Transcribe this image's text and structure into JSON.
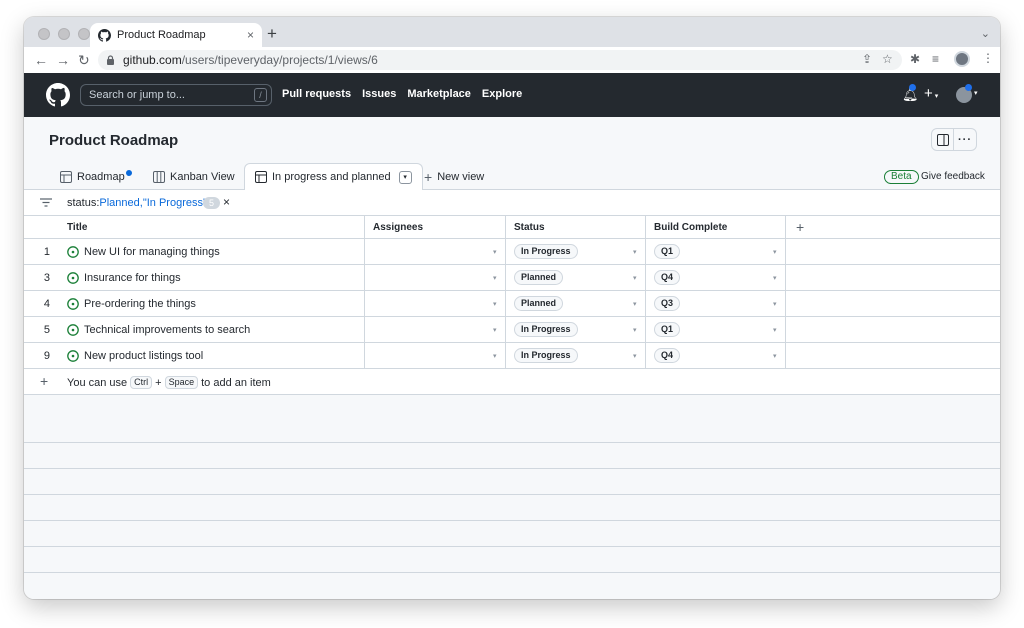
{
  "browser": {
    "tab_title": "Product Roadmap",
    "tab_close": "×",
    "new_tab": "+",
    "url_host": "github.com",
    "url_path": "/users/tipeveryday/projects/1/views/6"
  },
  "github_header": {
    "search_placeholder": "Search or jump to...",
    "search_shortcut": "/",
    "nav": [
      "Pull requests",
      "Issues",
      "Marketplace",
      "Explore"
    ],
    "plus_label": "+"
  },
  "project": {
    "title": "Product Roadmap",
    "more_label": "···",
    "views": [
      {
        "label": "Roadmap",
        "icon": "table-icon",
        "unsaved_dot": true
      },
      {
        "label": "Kanban View",
        "icon": "board-icon"
      },
      {
        "label": "In progress and planned",
        "icon": "table-icon",
        "active": true
      },
      {
        "label": "New view",
        "icon": "plus-icon"
      }
    ],
    "beta_label": "Beta",
    "feedback_label": "Give feedback"
  },
  "filter": {
    "key": "status:",
    "value": "Planned,\"In Progress\"",
    "count": "5",
    "clear": "×"
  },
  "table": {
    "columns": [
      "Title",
      "Assignees",
      "Status",
      "Build Complete"
    ],
    "add_column": "+",
    "rows": [
      {
        "num": "1",
        "title": "New UI for managing things",
        "assignees": "",
        "status": "In Progress",
        "build": "Q1"
      },
      {
        "num": "3",
        "title": "Insurance for things",
        "assignees": "",
        "status": "Planned",
        "build": "Q4"
      },
      {
        "num": "4",
        "title": "Pre-ordering the things",
        "assignees": "",
        "status": "Planned",
        "build": "Q3"
      },
      {
        "num": "5",
        "title": "Technical improvements to search",
        "assignees": "",
        "status": "In Progress",
        "build": "Q1"
      },
      {
        "num": "9",
        "title": "New product listings tool",
        "assignees": "",
        "status": "In Progress",
        "build": "Q4"
      }
    ],
    "add_item": {
      "plus": "+",
      "prefix": "You can use",
      "key1": "Ctrl",
      "joiner": "+",
      "key2": "Space",
      "suffix": "to add an item"
    }
  },
  "colors": {
    "header_bg": "#24292f",
    "link_blue": "#0969da",
    "open_issue_green": "#1a7f37",
    "border": "#d0d7de"
  }
}
